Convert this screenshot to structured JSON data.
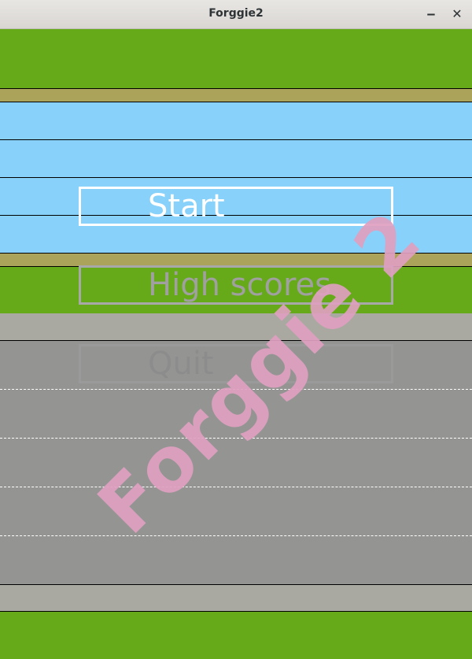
{
  "window": {
    "title": "Forggie2",
    "minimize_glyph": "‒",
    "close_glyph": "✕"
  },
  "menu": {
    "start_label": "Start",
    "highscores_label": "High scores",
    "quit_label": "Quit"
  },
  "watermark": {
    "text": "Forggie 2"
  },
  "colors": {
    "grass": "#66aa1a",
    "sand": "#aca35b",
    "water": "#87d1fa",
    "sidewalk": "#a9a9a1",
    "road": "#949593",
    "start_border": "#ffffff",
    "highscores_text": "#a0a0a0",
    "quit_text": "#8c8c8c",
    "watermark": "#e0a0c0"
  }
}
